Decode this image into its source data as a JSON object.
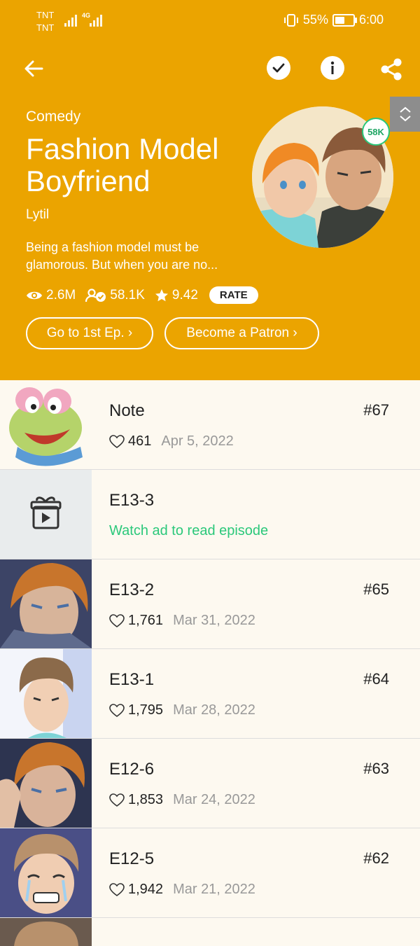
{
  "status_bar": {
    "carrier_1": "TNT",
    "carrier_2": "TNT",
    "network": "4G",
    "battery": "55%",
    "time": "6:00"
  },
  "toolbar": {
    "back_icon": "arrow-left-icon",
    "subscribe_icon": "check-icon",
    "info_icon": "info-icon",
    "share_icon": "share-icon"
  },
  "series": {
    "genre": "Comedy",
    "title": "Fashion Model Boyfriend",
    "author": "Lytil",
    "description": "Being a fashion model must be glamorous. But when you are no...",
    "views": "2.6M",
    "subscribers": "58.1K",
    "rating": "9.42",
    "rate_label": "RATE",
    "cover_badge": "58K",
    "first_ep_label": "Go to 1st Ep. ›",
    "patron_label": "Become a Patron ›"
  },
  "colors": {
    "header": "#eba400",
    "accent_green": "#2bc87a",
    "list_bg": "#fdf9f0"
  },
  "episodes": [
    {
      "title": "Note",
      "number": "#67",
      "likes": "461",
      "date": "Apr 5, 2022"
    },
    {
      "title": "E13-3",
      "locked_text": "Watch ad to read episode"
    },
    {
      "title": "E13-2",
      "number": "#65",
      "likes": "1,761",
      "date": "Mar 31, 2022"
    },
    {
      "title": "E13-1",
      "number": "#64",
      "likes": "1,795",
      "date": "Mar 28, 2022"
    },
    {
      "title": "E12-6",
      "number": "#63",
      "likes": "1,853",
      "date": "Mar 24, 2022"
    },
    {
      "title": "E12-5",
      "number": "#62",
      "likes": "1,942",
      "date": "Mar 21, 2022"
    }
  ]
}
